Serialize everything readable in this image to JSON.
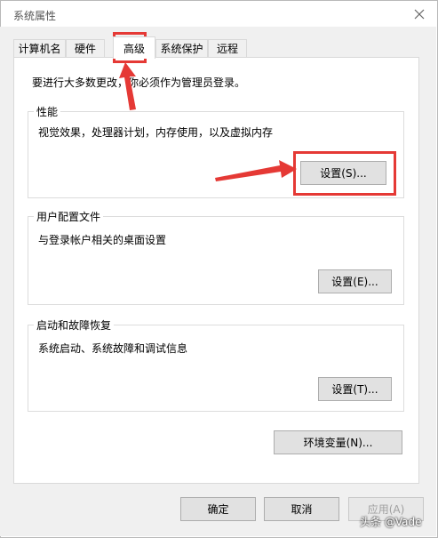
{
  "window": {
    "title": "系统属性"
  },
  "tabs": [
    {
      "label": "计算机名"
    },
    {
      "label": "硬件"
    },
    {
      "label": "高级"
    },
    {
      "label": "系统保护"
    },
    {
      "label": "远程"
    }
  ],
  "notice": "要进行大多数更改，你必须作为管理员登录。",
  "performance": {
    "title": "性能",
    "desc": "视觉效果，处理器计划，内存使用，以及虚拟内存",
    "button": "设置(S)..."
  },
  "profile": {
    "title": "用户配置文件",
    "desc": "与登录帐户相关的桌面设置",
    "button": "设置(E)..."
  },
  "startup": {
    "title": "启动和故障恢复",
    "desc": "系统启动、系统故障和调试信息",
    "button": "设置(T)..."
  },
  "env_button": "环境变量(N)...",
  "footer": {
    "ok": "确定",
    "cancel": "取消",
    "apply": "应用(A)"
  },
  "watermark": "头条 @Vade",
  "colors": {
    "highlight": "#e53935",
    "window_bg": "#f0f0f0",
    "panel_bg": "#ffffff"
  }
}
